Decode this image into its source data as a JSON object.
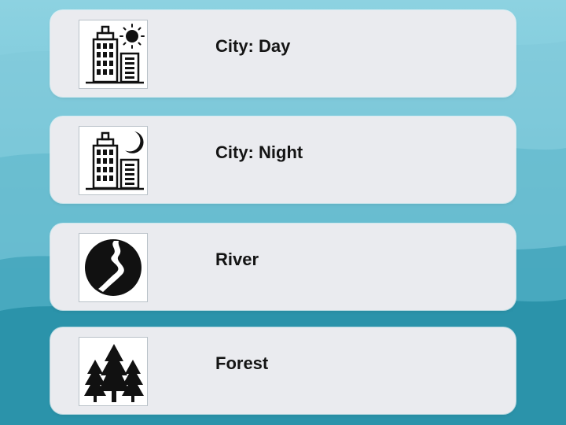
{
  "scene_list": {
    "items": [
      {
        "label": "City: Day",
        "icon": "city-day-icon"
      },
      {
        "label": "City: Night",
        "icon": "city-night-icon"
      },
      {
        "label": "River",
        "icon": "river-icon"
      },
      {
        "label": "Forest",
        "icon": "forest-icon"
      }
    ]
  },
  "colors": {
    "background_sky": "#7ccbdc",
    "background_mountains": "#2c93a8",
    "card": "#eaebef",
    "label_text": "#141414",
    "icon": "#111111"
  }
}
